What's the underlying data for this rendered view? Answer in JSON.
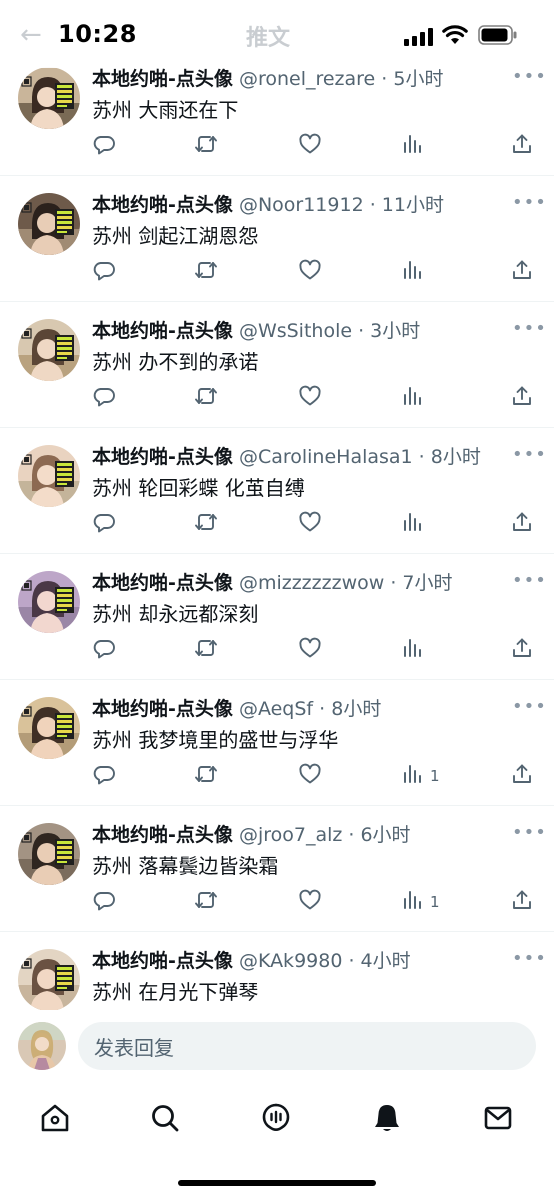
{
  "status_bar": {
    "time": "10:28"
  },
  "header": {
    "back_glyph": "←",
    "title": "推文"
  },
  "tweets": [
    {
      "name": "本地约啪-点头像",
      "handle": "@ronel_rezare",
      "time": "5小时",
      "text": "苏州 大雨还在下",
      "views": ""
    },
    {
      "name": "本地约啪-点头像",
      "handle": "@Noor11912",
      "time": "11小时",
      "text": "苏州 剑起江湖恩怨",
      "views": ""
    },
    {
      "name": "本地约啪-点头像",
      "handle": "@WsSithole",
      "time": "3小时",
      "text": "苏州 办不到的承诺",
      "views": ""
    },
    {
      "name": "本地约啪-点头像",
      "handle": "@CarolineHalasa1",
      "time": "8小时",
      "text": "苏州 轮回彩蝶 化茧自缚",
      "views": ""
    },
    {
      "name": "本地约啪-点头像",
      "handle": "@mizzzzzzwow",
      "time": "7小时",
      "text": "苏州 却永远都深刻",
      "views": ""
    },
    {
      "name": "本地约啪-点头像",
      "handle": "@AeqSf",
      "time": "8小时",
      "text": "苏州 我梦境里的盛世与浮华",
      "views": "1"
    },
    {
      "name": "本地约啪-点头像",
      "handle": "@jroo7_alz",
      "time": "6小时",
      "text": "苏州 落幕鬓边皆染霜",
      "views": "1"
    },
    {
      "name": "本地约啪-点头像",
      "handle": "@KAk9980",
      "time": "4小时",
      "text": "苏州 在月光下弹琴",
      "views": ""
    }
  ],
  "reply_bar": {
    "placeholder": "发表回复"
  },
  "tab_bar": {
    "icons": [
      "home-icon",
      "search-icon",
      "spaces-icon",
      "notifications-icon",
      "messages-icon"
    ]
  },
  "colors": {
    "text": "#0f1419",
    "secondary": "#536471",
    "divider": "#eff3f4",
    "input_bg": "#eff3f4"
  }
}
